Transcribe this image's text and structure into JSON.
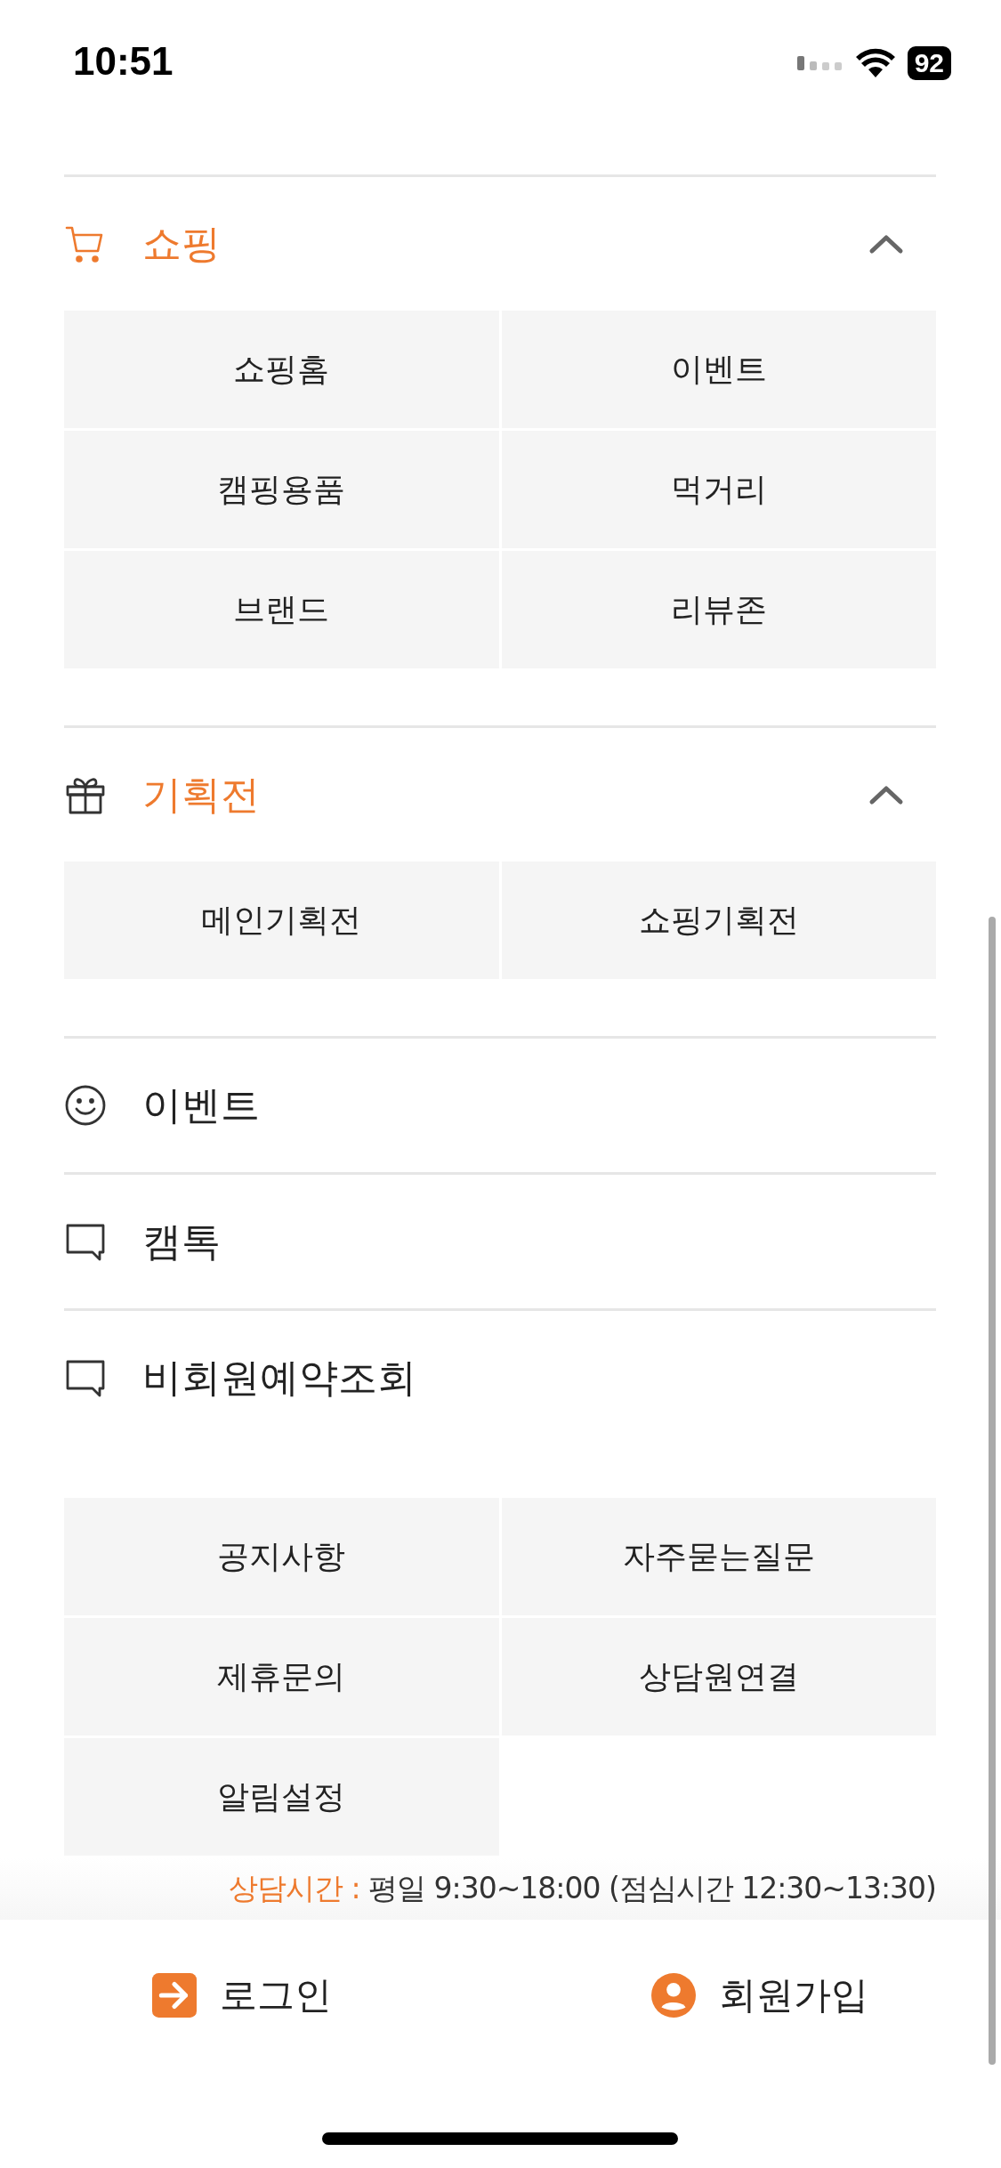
{
  "status_bar": {
    "time": "10:51",
    "battery": "92"
  },
  "sections": [
    {
      "title": "쇼핑",
      "kind": "cart",
      "expanded": true,
      "items": [
        "쇼핑홈",
        "이벤트",
        "캠핑용품",
        "먹거리",
        "브랜드",
        "리뷰존"
      ]
    },
    {
      "title": "기획전",
      "kind": "gift",
      "expanded": true,
      "items": [
        "메인기획전",
        "쇼핑기획전"
      ]
    }
  ],
  "links": [
    {
      "label": "이벤트",
      "kind": "smiley"
    },
    {
      "label": "캠톡",
      "kind": "chat"
    },
    {
      "label": "비회원예약조회",
      "kind": "chat"
    }
  ],
  "support_menu": [
    "공지사항",
    "자주묻는질문",
    "제휴문의",
    "상담원연결",
    "알림설정"
  ],
  "consult_hours": {
    "label": "상담시간 :",
    "text": "평일 9:30~18:00 (점심시간 12:30~13:30)"
  },
  "bottom_actions": [
    {
      "label": "로그인",
      "kind": "login"
    },
    {
      "label": "회원가입",
      "kind": "user"
    }
  ]
}
